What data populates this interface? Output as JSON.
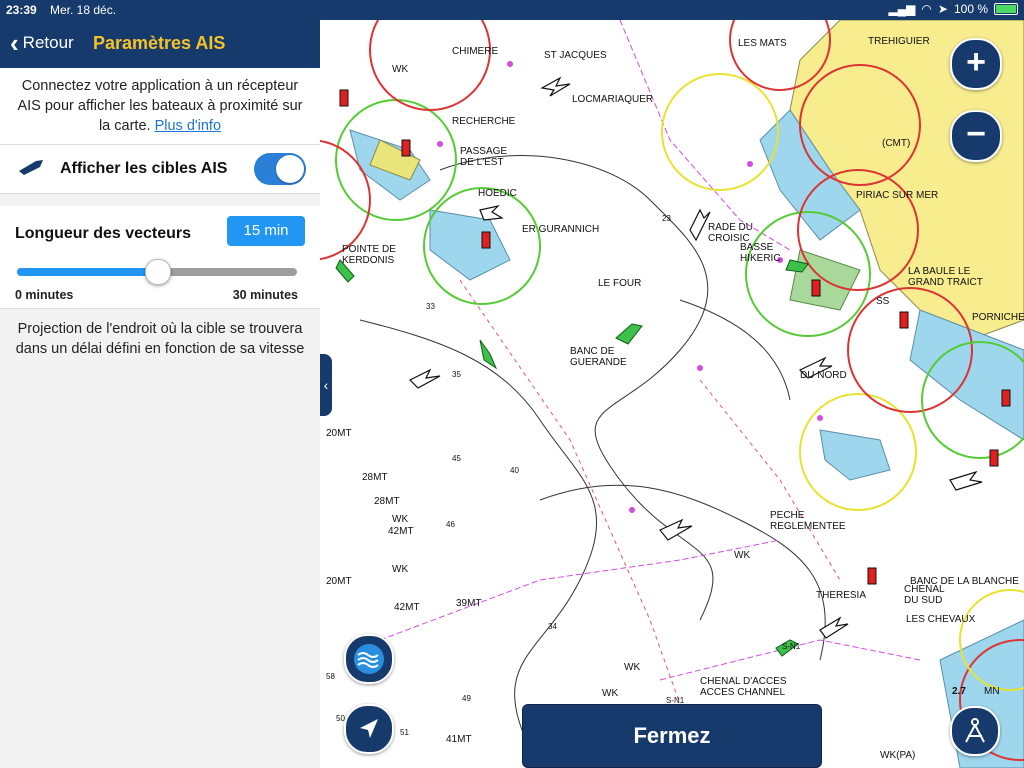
{
  "status": {
    "time": "23:39",
    "date": "Mer. 18 déc.",
    "battery": "100 %"
  },
  "nav": {
    "back_label": "Retour",
    "title": "Paramètres AIS"
  },
  "desc": {
    "text": "Connectez votre application à un récepteur AIS pour afficher les bateaux à proximité sur la carte.",
    "link": "Plus d'info"
  },
  "ais_toggle": {
    "label": "Afficher les cibles AIS",
    "on": true
  },
  "vector": {
    "label": "Longueur des vecteurs",
    "value_label": "15 min",
    "min_label": "0 minutes",
    "max_label": "30 minutes",
    "fraction": 0.5
  },
  "help_text": "Projection de l'endroit où la cible se trouvera dans un délai défini en fonction de sa vitesse",
  "map": {
    "labels": [
      "CHIMERE",
      "ST JACQUES",
      "LES MATS",
      "TREHIGUIER",
      "WK",
      "LOCMARIAQUER",
      "RECHERCHE",
      "PASSAGE DE L'EST",
      "HOEDIC",
      "ER GURANNICH",
      "RADE DU CROISIC",
      "BASSE HIKERIC",
      "PIRIAC SUR MER",
      "(CMT)",
      "POINTE DE KERDONIS",
      "LE FOUR",
      "LA BAULE LE GRAND TRAICT",
      "SS",
      "PORNICHET",
      "BANC DE GUERANDE",
      "DU NORD",
      "20MT",
      "28MT",
      "28MT",
      "WK",
      "42MT",
      "PECHE REGLEMENTEE",
      "WK",
      "20MT",
      "WK",
      "42MT",
      "39MT",
      "THERESIA",
      "BANC DE LA BLANCHE",
      "CHENAL DU SUD",
      "LES CHEVAUX",
      "CHENAL D'ACCES ACCES CHANNEL",
      "WK",
      "WK",
      "41MT",
      "WK(PA)",
      "2.7",
      "MN",
      "23",
      "33",
      "35",
      "45",
      "40",
      "46",
      "34",
      "49",
      "51",
      "58",
      "50",
      "S-N1",
      "S-N1"
    ],
    "zoom_in": "+",
    "zoom_out": "−",
    "close_label": "Fermez"
  },
  "colors": {
    "navy": "#163a6b",
    "accent": "#2196f3",
    "title": "#f6c22a"
  },
  "icons": {
    "back": "chevron-left-icon",
    "ship": "ship-icon",
    "tide": "tide-icon",
    "locate": "navigation-arrow-icon",
    "compass": "compass-icon",
    "panel_tab": "chevron-left-icon"
  }
}
